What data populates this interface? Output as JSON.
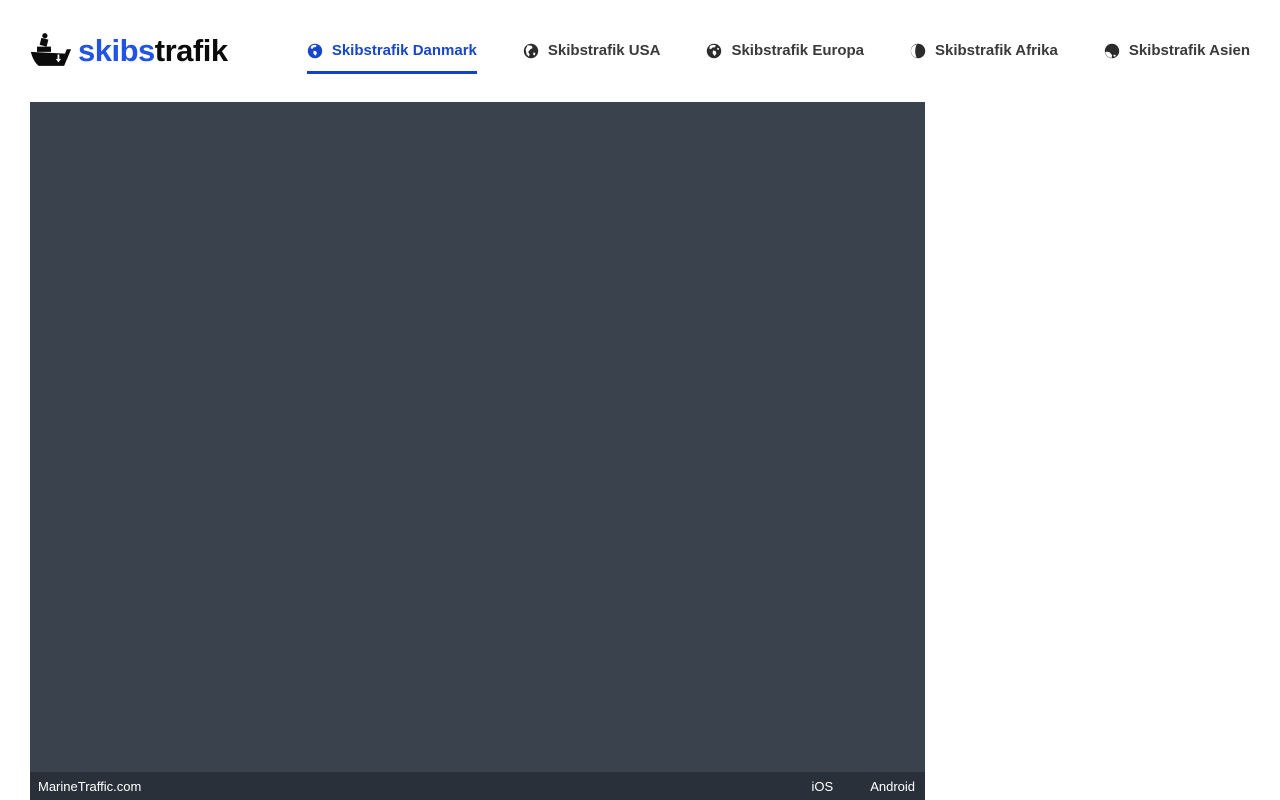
{
  "logo": {
    "text_primary": "skibs",
    "text_secondary": "trafik"
  },
  "nav": {
    "items": [
      {
        "label": "Skibstrafik Danmark",
        "active": true
      },
      {
        "label": "Skibstrafik USA",
        "active": false
      },
      {
        "label": "Skibstrafik Europa",
        "active": false
      },
      {
        "label": "Skibstrafik Afrika",
        "active": false
      },
      {
        "label": "Skibstrafik Asien",
        "active": false
      }
    ]
  },
  "map": {
    "attribution": "MarineTraffic.com",
    "store_links": [
      {
        "label": "iOS"
      },
      {
        "label": "Android"
      }
    ]
  },
  "colors": {
    "accent_active_nav": "#1747c8",
    "logo_blue": "#2153e6",
    "nav_text": "#3a3a3a",
    "map_background": "#3a424e",
    "attribution_bar_background": "#293039"
  }
}
